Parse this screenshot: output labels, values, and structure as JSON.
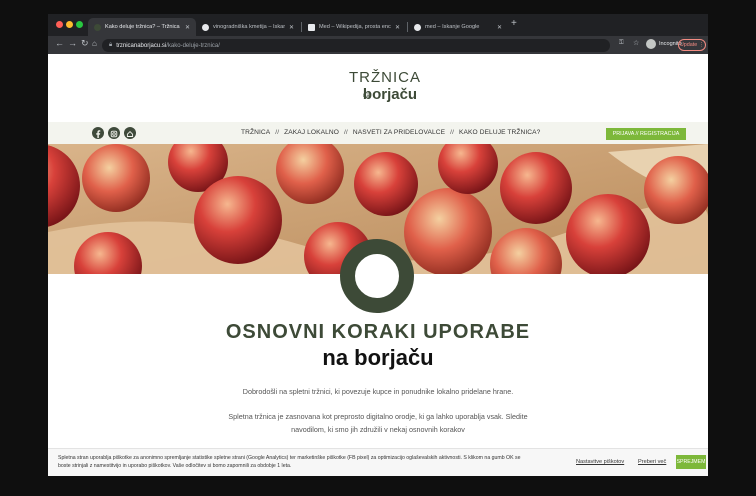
{
  "browser": {
    "tabs": [
      {
        "title": "Kako deluje tržnica? – Tržnica",
        "active": true
      },
      {
        "title": "vinogradniška kmetija – Iskanje"
      },
      {
        "title": "Med – Wikipedija, prosta encikl"
      },
      {
        "title": "med – Iskanje Google"
      }
    ],
    "new_tab": "+",
    "url_host": "trznicanaborjacu.si",
    "url_path": "/kako-deluje-trznica/",
    "profile_label": "Incognito",
    "update_label": "Update"
  },
  "site": {
    "logo": {
      "main": "TRŽNICA",
      "prefix": "na",
      "sub": "borjaču"
    },
    "social_icons": [
      "facebook-icon",
      "instagram-icon",
      "home-icon"
    ],
    "menu": [
      "TRŽNICA",
      "ZAKAJ LOKALNO",
      "NASVETI ZA PRIDELOVALCE",
      "KAKO DELUJE TRŽNICA?"
    ],
    "menu_separator": "//",
    "register_label": "PRIJAVA // REGISTRACIJA",
    "heading": "OSNOVNI KORAKI UPORABE",
    "subheading": "na borjaču",
    "paragraph1": "Dobrodošli na spletni tržnici, ki povezuje kupce in ponudnike lokalno pridelane hrane.",
    "paragraph2": "Spletna tržnica je zasnovana kot preprosto digitalno orodje, ki ga lahko uporablja vsak. Sledite navodilom, ki smo jih združili v nekaj osnovnih korakov"
  },
  "cookie": {
    "text": "Spletna stran uporablja piškotke za anonimno spremljanje statistike spletne strani (Google Analytics) ter marketinške piškotke (FB pixel) za optimizacijo oglaševalskih aktivnosti. S klikom na gumb OK se boste strinjali z namestitvijo in uporabo piškotkov. Vaše odločitev si bomo zapomnili za obdobje 1 leta.",
    "settings_label": "Nastavitve piškotov",
    "more_label": "Preberi več",
    "accept_label": "SPREJMEM"
  },
  "colors": {
    "brand_dark": "#3d4a37",
    "brand_green": "#7db83a"
  }
}
